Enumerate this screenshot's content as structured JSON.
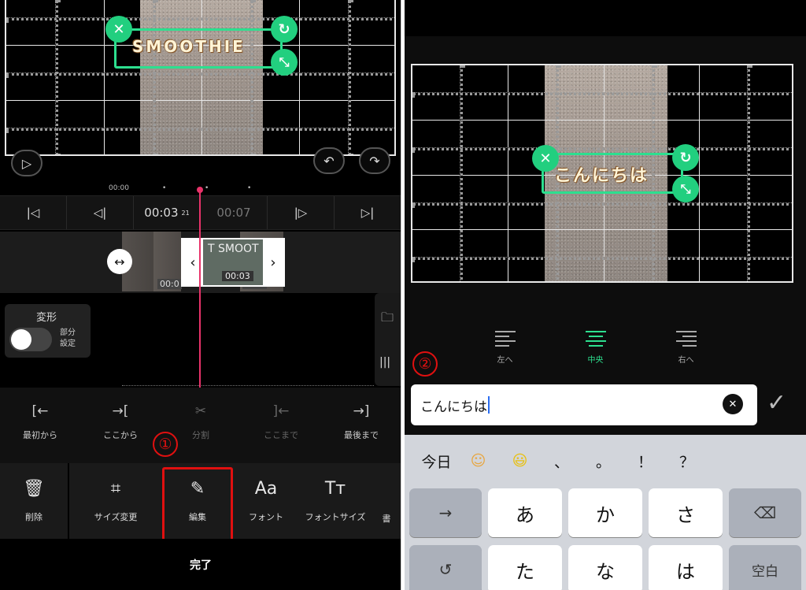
{
  "left": {
    "overlay_text": "SMOOTHIE",
    "ruler": {
      "start": "00:00"
    },
    "transport": {
      "current_time": "00:03",
      "current_frame": "21",
      "end_time": "00:07"
    },
    "clip": {
      "label": "T SMOOT",
      "duration": "00:03",
      "under_left": "00:0",
      "under_right": "00:0"
    },
    "transform": {
      "title": "変形",
      "toggle_label": "部分\n設定"
    },
    "edit_row": [
      {
        "icon": "[←",
        "label": "最初から"
      },
      {
        "icon": "→[",
        "label": "ここから"
      },
      {
        "icon": "✂",
        "label": "分割"
      },
      {
        "icon": "]←",
        "label": "ここまで"
      },
      {
        "icon": "→]",
        "label": "最後まで"
      }
    ],
    "toolbar": {
      "delete": "削除",
      "resize": "サイズ変更",
      "edit": "編集",
      "font": "フォント",
      "font_icon": "Aa",
      "fontsize": "フォントサイズ",
      "fontsize_icon": "Tт",
      "partial": "書"
    },
    "done": "完了",
    "marker1": "①"
  },
  "right": {
    "overlay_text": "こんにちは",
    "align": [
      {
        "label": "左へ"
      },
      {
        "label": "中央"
      },
      {
        "label": "右へ"
      }
    ],
    "marker2": "②",
    "input_value": "こんにちは",
    "keyboard": {
      "suggestions": [
        "今日",
        "☺",
        "😃",
        "、",
        "。",
        "！",
        "？"
      ],
      "row1": [
        "→",
        "あ",
        "か",
        "さ",
        "⌫"
      ],
      "row2": [
        "↺",
        "た",
        "な",
        "は",
        "空白"
      ]
    }
  }
}
